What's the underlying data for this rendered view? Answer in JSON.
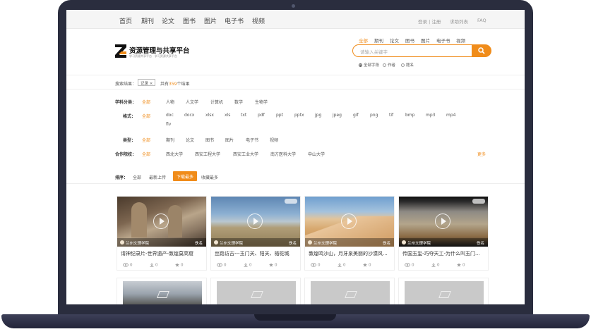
{
  "colors": {
    "accent": "#f08c1a",
    "bezel": "#2a2d3e"
  },
  "topnav": {
    "items": [
      "首页",
      "期刊",
      "论文",
      "图书",
      "图片",
      "电子书",
      "视频"
    ],
    "right": [
      "登录 | 注册",
      "求助列表",
      "FAQ"
    ]
  },
  "header": {
    "logo_title": "资源管理与共享平台",
    "logo_sub": "学习资源共享平台 · 学习资源共享平台",
    "search_types": [
      "全部",
      "期刊",
      "论文",
      "图书",
      "图片",
      "电子书",
      "视频"
    ],
    "search_placeholder": "请输入关键字",
    "radios": [
      "全部字段",
      "作者",
      "题名"
    ]
  },
  "results": {
    "label": "搜索结果：",
    "tag": "记录",
    "count_prefix": "共有",
    "count": "359",
    "count_suffix": "个结果"
  },
  "filters": [
    {
      "label": "学科分类：",
      "options": [
        "全部",
        "人物",
        "人文学",
        "计算机",
        "数学",
        "生物学"
      ]
    },
    {
      "label": "格式：",
      "options": [
        "全部",
        "doc",
        "docx",
        "xlsx",
        "xls",
        "txt",
        "pdf",
        "ppt",
        "pptx",
        "jpg",
        "jpeg",
        "gif",
        "png",
        "tif",
        "bmp",
        "mp3",
        "mp4",
        "flv"
      ]
    },
    {
      "label": "类型：",
      "options": [
        "全部",
        "期刊",
        "论文",
        "图书",
        "图片",
        "电子书",
        "视频"
      ]
    },
    {
      "label": "合作院校：",
      "options": [
        "全部",
        "西北大学",
        "西安工程大学",
        "西安工业大学",
        "南方医科大学",
        "中山大学"
      ],
      "more": "更多"
    }
  ],
  "sort": {
    "label": "排序：",
    "options": [
      "全部",
      "最新上传",
      "下载最多",
      "收藏最多"
    ],
    "active": "下载最多"
  },
  "cards": [
    {
      "school": "兰州文理学院",
      "author": "佚名",
      "title": "请神纪录片-世界遗产-敦煌莫高窟",
      "views": "0",
      "downloads": "0",
      "stars": "0"
    },
    {
      "school": "兰州文理学院",
      "author": "佚名",
      "title": "丝路访古---玉门关、阳关、骆驼城",
      "views": "0",
      "downloads": "0",
      "stars": "0"
    },
    {
      "school": "兰州文理学院",
      "author": "佚名",
      "title": "敦煌鸣沙山，月牙泉美丽的沙漠风...",
      "views": "0",
      "downloads": "0",
      "stars": "0"
    },
    {
      "school": "兰州文理学院",
      "author": "佚名",
      "title": "传国玉玺-巧夺天工-为什么叫玉门...",
      "views": "0",
      "downloads": "0",
      "stars": "0"
    }
  ]
}
